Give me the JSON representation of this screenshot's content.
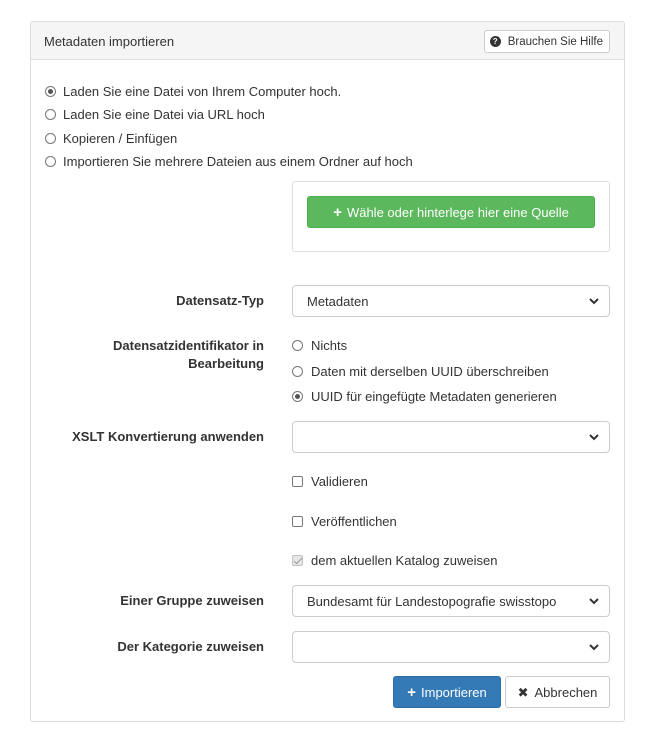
{
  "panel": {
    "title": "Metadaten importieren",
    "help_label": "Brauchen Sie Hilfe"
  },
  "source": {
    "options": [
      {
        "label": "Laden Sie eine Datei von Ihrem Computer hoch.",
        "checked": true
      },
      {
        "label": "Laden Sie eine Datei via URL hoch",
        "checked": false
      },
      {
        "label": "Kopieren / Einfügen",
        "checked": false
      },
      {
        "label": "Importieren Sie mehrere Dateien aus einem Ordner auf hoch",
        "checked": false
      }
    ],
    "choose_label": "Wähle oder hinterlege hier eine Quelle"
  },
  "form": {
    "record_type": {
      "label": "Datensatz-Typ",
      "value": "Metadaten"
    },
    "identifier": {
      "label_line1": "Datensatzidentifikator in",
      "label_line2": "Bearbeitung",
      "options": [
        {
          "label": "Nichts",
          "checked": false
        },
        {
          "label": "Daten mit derselben UUID überschreiben",
          "checked": false
        },
        {
          "label": "UUID für eingefügte Metadaten generieren",
          "checked": true
        }
      ]
    },
    "xslt": {
      "label": "XSLT Konvertierung anwenden",
      "value": ""
    },
    "validate_label": "Validieren",
    "publish_label": "Veröffentlichen",
    "catalog_label": "dem aktuellen Katalog zuweisen",
    "group": {
      "label": "Einer Gruppe zuweisen",
      "value": "Bundesamt für Landestopografie swisstopo"
    },
    "category": {
      "label": "Der Kategorie zuweisen",
      "value": ""
    }
  },
  "actions": {
    "import_label": "Importieren",
    "cancel_label": "Abbrechen"
  },
  "colors": {
    "success": "#5cb85c",
    "primary": "#337ab7"
  }
}
